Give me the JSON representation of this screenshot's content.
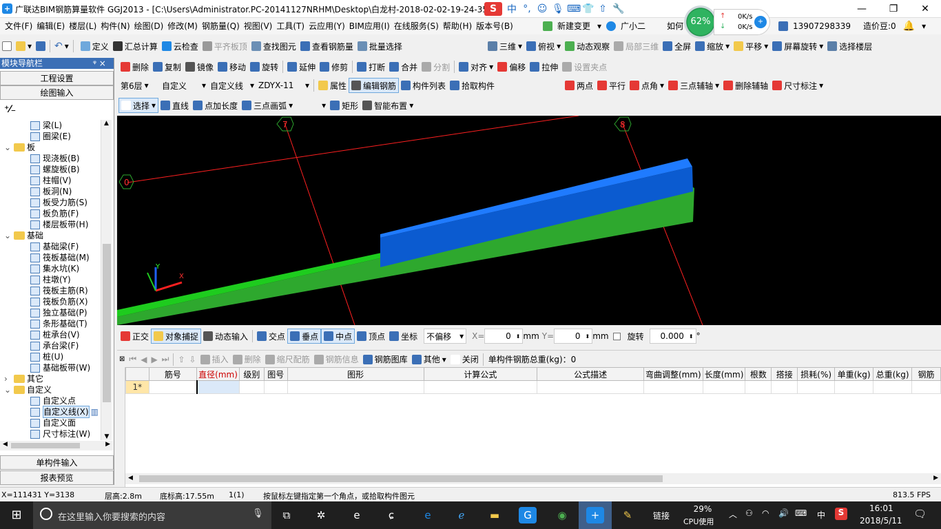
{
  "app": {
    "title": "广联达BIM钢筋算量软件 GGJ2013 - [C:\\Users\\Administrator.PC-20141127NRHM\\Desktop\\白龙村-2018-02-02-19-24-35",
    "ime": {
      "logo": "S",
      "lang": "中",
      "punct": "°,"
    }
  },
  "perf": {
    "cpu_badge": "62%",
    "up_speed": "0K/s",
    "down_speed": "0K/s"
  },
  "menu": [
    "文件(F)",
    "编辑(E)",
    "楼层(L)",
    "构件(N)",
    "绘图(D)",
    "修改(M)",
    "钢筋量(Q)",
    "视图(V)",
    "工具(T)",
    "云应用(Y)",
    "BIM应用(I)",
    "在线服务(S)",
    "帮助(H)",
    "版本号(B)"
  ],
  "menu_extra": {
    "new_change": "新建变更",
    "assistant": "广小二",
    "how": "如何",
    "phone": "13907298339",
    "cost_bean": "造价豆:0"
  },
  "toolbar1": [
    "定义",
    "汇总计算",
    "云检查",
    "平齐板顶",
    "查找图元",
    "查看钢筋量",
    "批量选择"
  ],
  "toolbar1_right": [
    "三维",
    "俯视",
    "动态观察",
    "局部三维",
    "全屏",
    "缩放",
    "平移",
    "屏幕旋转",
    "选择楼层"
  ],
  "toolbar2": [
    "删除",
    "复制",
    "镜像",
    "移动",
    "旋转",
    "延伸",
    "修剪",
    "打断",
    "合并",
    "分割",
    "对齐",
    "偏移",
    "拉伸",
    "设置夹点"
  ],
  "toolbar3": {
    "floor": "第6层",
    "type": "自定义",
    "subtype": "自定义线",
    "name": "ZDYX-11",
    "items": [
      "属性",
      "编辑钢筋",
      "构件列表",
      "拾取构件"
    ],
    "right": [
      "两点",
      "平行",
      "点角",
      "三点辅轴",
      "删除辅轴",
      "尺寸标注"
    ]
  },
  "toolbar4": [
    "选择",
    "直线",
    "点加长度",
    "三点画弧",
    "矩形",
    "智能布置"
  ],
  "panel": {
    "title": "模块导航栏",
    "pin": "ᵠ ×",
    "btn_project": "工程设置",
    "btn_draw": "绘图输入",
    "btn_single": "单构件输入",
    "btn_report": "报表预览"
  },
  "tree": [
    {
      "label": "梁(L)",
      "level": 2
    },
    {
      "label": "圈梁(E)",
      "level": 2
    },
    {
      "label": "板",
      "level": 1,
      "folder": true
    },
    {
      "label": "现浇板(B)",
      "level": 2
    },
    {
      "label": "螺旋板(B)",
      "level": 2
    },
    {
      "label": "柱帽(V)",
      "level": 2
    },
    {
      "label": "板洞(N)",
      "level": 2
    },
    {
      "label": "板受力筋(S)",
      "level": 2
    },
    {
      "label": "板负筋(F)",
      "level": 2
    },
    {
      "label": "楼层板带(H)",
      "level": 2
    },
    {
      "label": "基础",
      "level": 1,
      "folder": true
    },
    {
      "label": "基础梁(F)",
      "level": 2
    },
    {
      "label": "筏板基础(M)",
      "level": 2
    },
    {
      "label": "集水坑(K)",
      "level": 2
    },
    {
      "label": "柱墩(Y)",
      "level": 2
    },
    {
      "label": "筏板主筋(R)",
      "level": 2
    },
    {
      "label": "筏板负筋(X)",
      "level": 2
    },
    {
      "label": "独立基础(P)",
      "level": 2
    },
    {
      "label": "条形基础(T)",
      "level": 2
    },
    {
      "label": "桩承台(V)",
      "level": 2
    },
    {
      "label": "承台梁(F)",
      "level": 2
    },
    {
      "label": "桩(U)",
      "level": 2
    },
    {
      "label": "基础板带(W)",
      "level": 2
    },
    {
      "label": "其它",
      "level": 1,
      "folder": true,
      "collapsed": true
    },
    {
      "label": "自定义",
      "level": 1,
      "folder": true
    },
    {
      "label": "自定义点",
      "level": 2
    },
    {
      "label": "自定义线(X)",
      "level": 2,
      "selected": true
    },
    {
      "label": "自定义面",
      "level": 2
    },
    {
      "label": "尺寸标注(W)",
      "level": 2
    }
  ],
  "axes": {
    "a7": "7",
    "a8": "8",
    "a0": "0",
    "y": "Y",
    "x": "X"
  },
  "snapbar": {
    "items": [
      "正交",
      "对象捕捉",
      "动态输入",
      "交点",
      "垂点",
      "中点",
      "顶点",
      "坐标"
    ],
    "offset": "不偏移",
    "x_label": "X=",
    "x_val": "0",
    "y_label": "Y=",
    "y_val": "0",
    "mm": "mm",
    "rotate": "旋转",
    "rot_val": "0.000",
    "deg": "°"
  },
  "rebar_toolbar": {
    "items": [
      "插入",
      "删除",
      "缩尺配筋",
      "钢筋信息",
      "钢筋图库",
      "其他",
      "关闭"
    ],
    "total": "单构件钢筋总重(kg)：0"
  },
  "grid": {
    "columns": [
      "筋号",
      "直径(mm)",
      "级别",
      "图号",
      "图形",
      "计算公式",
      "公式描述",
      "弯曲调整(mm)",
      "长度(mm)",
      "根数",
      "搭接",
      "损耗(%)",
      "单重(kg)",
      "总重(kg)",
      "钢筋"
    ],
    "row1": "1*"
  },
  "status": {
    "coords": "X=111431 Y=3138",
    "floor_h": "层高:2.8m",
    "base_h": "底标高:17.55m",
    "count": "1(1)",
    "hint": "按鼠标左键指定第一个角点，或拾取构件图元",
    "fps": "813.5 FPS"
  },
  "taskbar": {
    "search": "在这里输入你要搜索的内容",
    "link": "链接",
    "cpu_pct": "29%",
    "cpu_label": "CPU使用",
    "ime": "中",
    "time": "16:01",
    "date": "2018/5/11"
  }
}
